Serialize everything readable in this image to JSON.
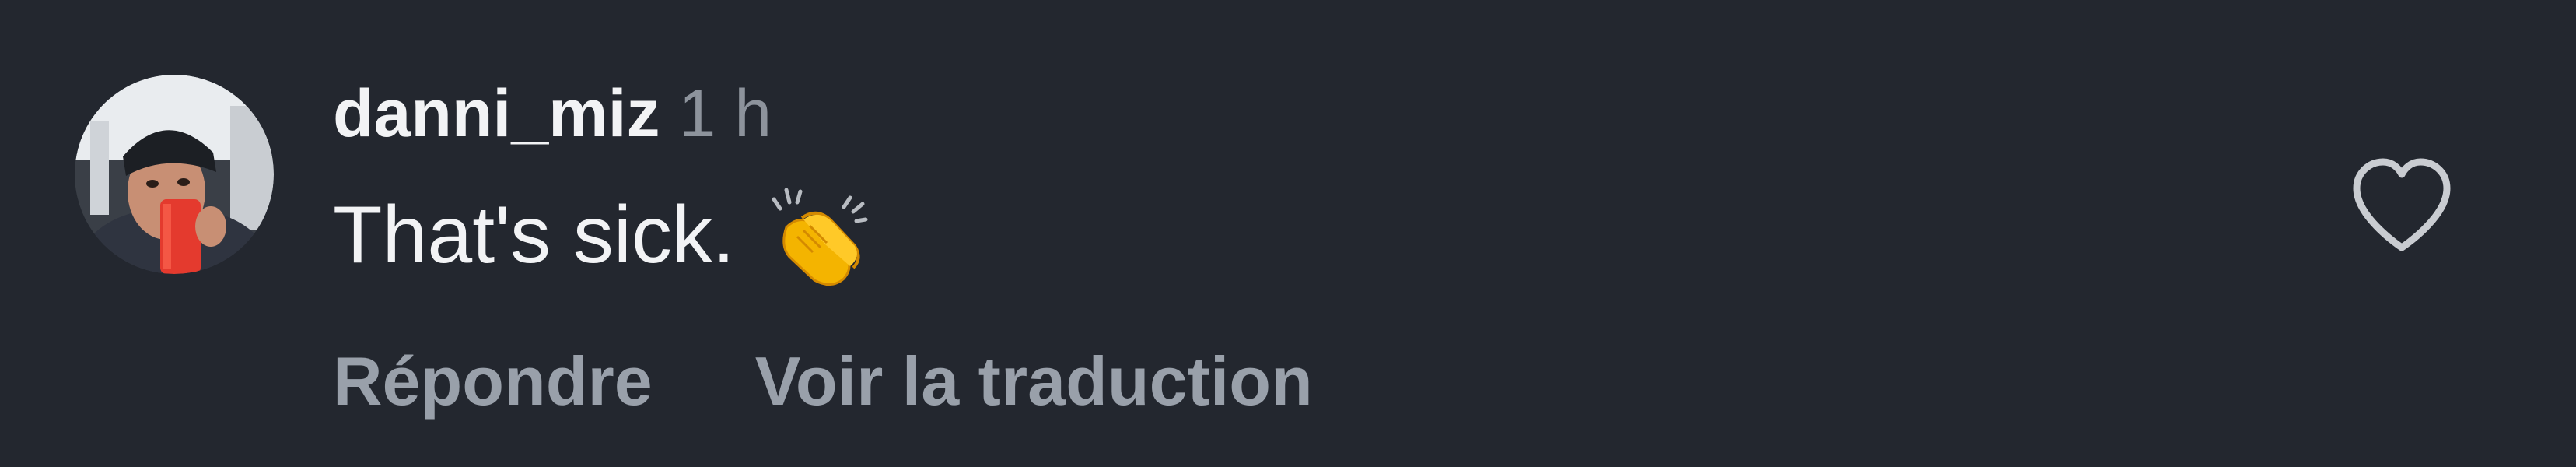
{
  "comment": {
    "username": "danni_miz",
    "time": "1 h",
    "text": "That's sick.",
    "emoji": "clapping-hands",
    "actions": {
      "reply": "Répondre",
      "translate": "Voir la traduction"
    },
    "like_icon": "heart-outline-icon"
  },
  "colors": {
    "background": "#23272f",
    "primary_text": "#f2f3f5",
    "secondary_text": "#8d939c",
    "action_text": "#99a0aa",
    "icon": "#c9ccd1"
  }
}
